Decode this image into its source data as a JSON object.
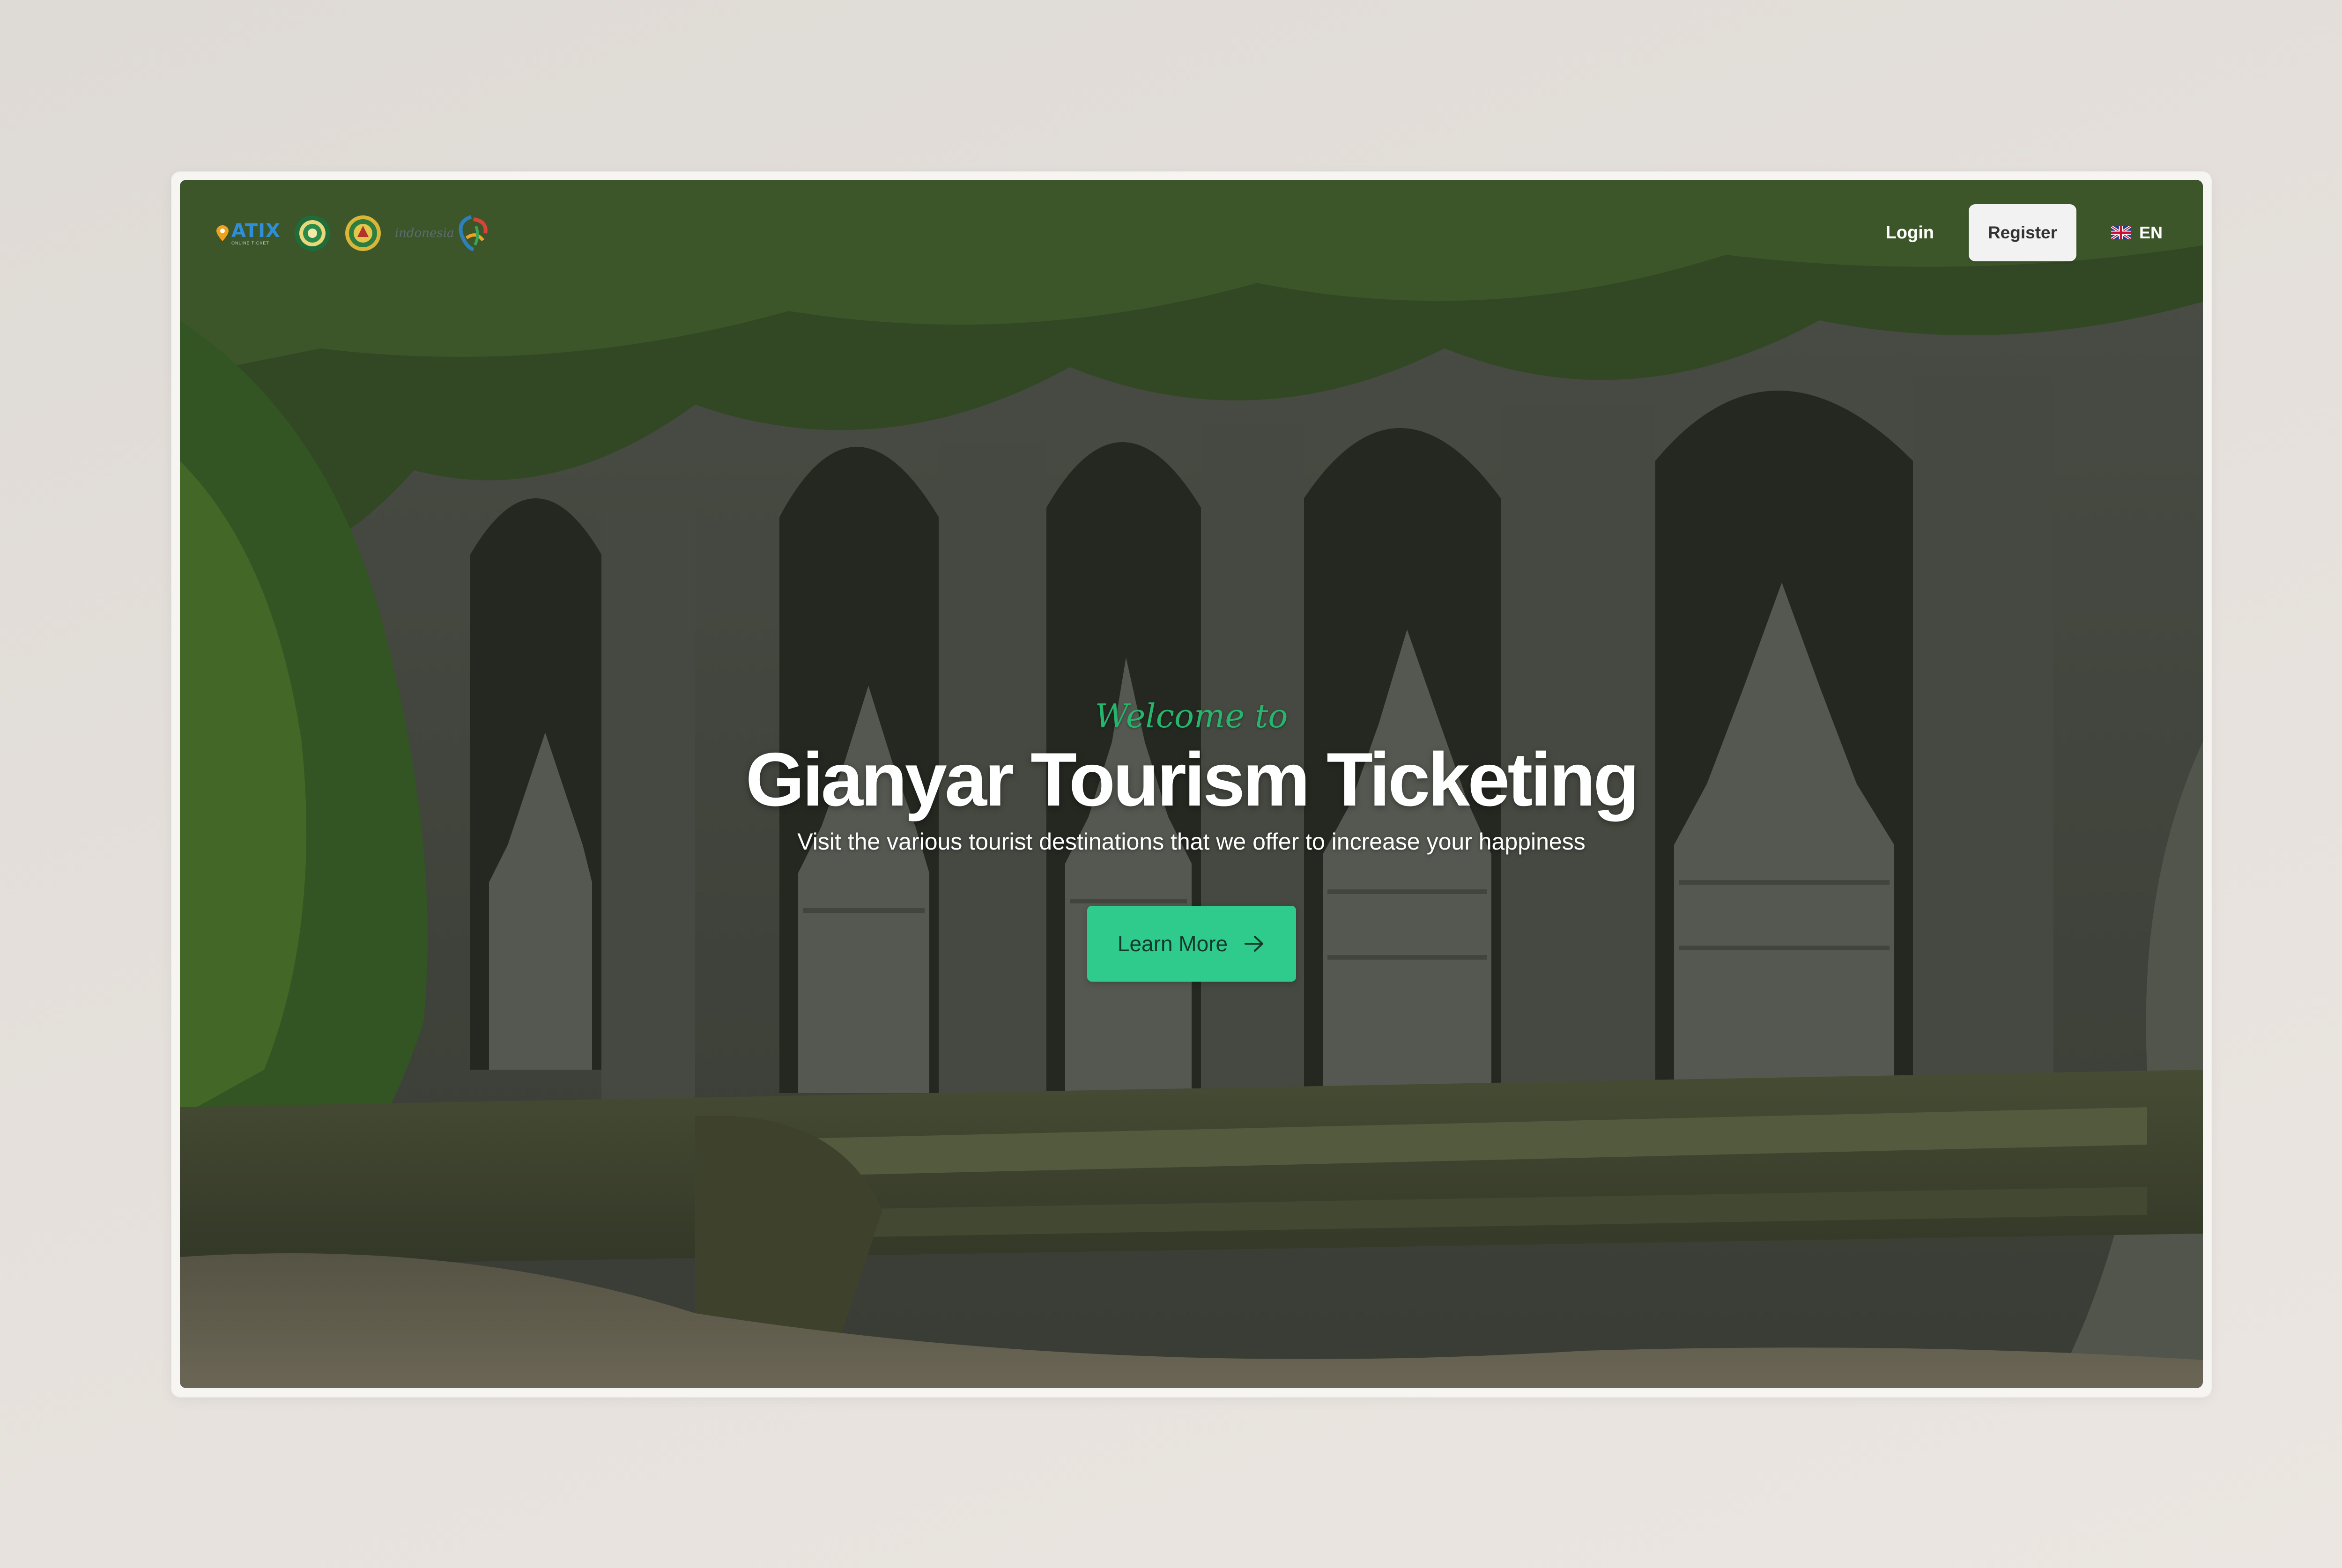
{
  "navbar": {
    "logos": {
      "atix_brand": "ATIX",
      "atix_tagline": "ONLINE TICKET",
      "indonesia_text": "indonesia"
    },
    "login_label": "Login",
    "register_label": "Register",
    "language": {
      "code": "EN",
      "flag_icon": "uk-flag-icon"
    }
  },
  "hero": {
    "welcome": "Welcome to",
    "title": "Gianyar Tourism Ticketing",
    "subtitle": "Visit the various tourist destinations that we offer to increase your happiness",
    "cta_label": "Learn More",
    "cta_icon": "arrow-right-icon"
  },
  "colors": {
    "accent_green": "#2ecb8c",
    "welcome_green": "#27b56d",
    "register_bg": "#f2f2f2",
    "atix_blue": "#2e8fd8"
  }
}
